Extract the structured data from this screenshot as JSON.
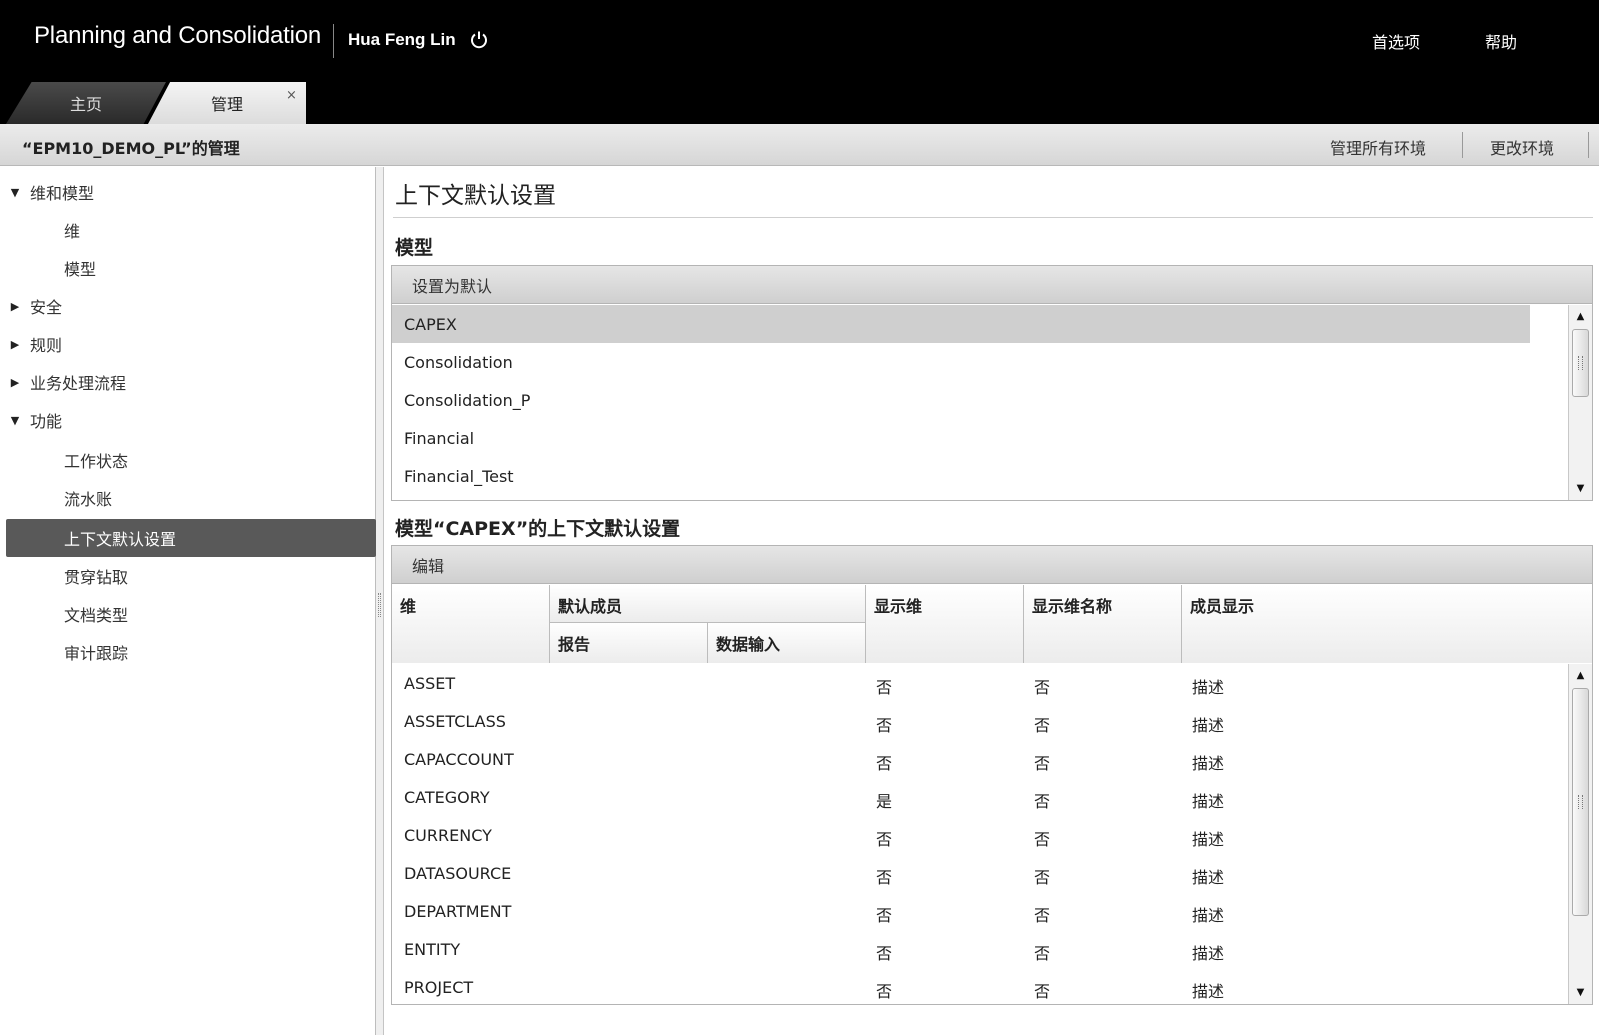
{
  "header": {
    "app_title": "Planning and Consolidation",
    "user_name": "Hua Feng Lin",
    "preferences": "首选项",
    "help": "帮助",
    "tabs": [
      "主页",
      "管理"
    ],
    "tab_close": "×"
  },
  "subheader": {
    "title": "“EPM10_DEMO_PL”的管理",
    "manage_all": "管理所有环境",
    "change_env": "更改环境"
  },
  "sidebar": {
    "items": [
      {
        "label": "维和模型",
        "type": "group",
        "expanded": true
      },
      {
        "label": "维",
        "type": "sub"
      },
      {
        "label": "模型",
        "type": "sub"
      },
      {
        "label": "安全",
        "type": "group",
        "expanded": false
      },
      {
        "label": "规则",
        "type": "group",
        "expanded": false
      },
      {
        "label": "业务处理流程",
        "type": "group",
        "expanded": false
      },
      {
        "label": "功能",
        "type": "group",
        "expanded": true
      },
      {
        "label": "工作状态",
        "type": "sub"
      },
      {
        "label": "流水账",
        "type": "sub"
      },
      {
        "label": "上下文默认设置",
        "type": "sub",
        "active": true
      },
      {
        "label": "贯穿钻取",
        "type": "sub"
      },
      {
        "label": "文档类型",
        "type": "sub"
      },
      {
        "label": "审计跟踪",
        "type": "sub"
      }
    ]
  },
  "main": {
    "title": "上下文默认设置",
    "models_heading": "模型",
    "set_default": "设置为默认",
    "models": [
      "CAPEX",
      "Consolidation",
      "Consolidation_P",
      "Financial",
      "Financial_Test"
    ],
    "selected_model": "CAPEX",
    "context_heading": "模型“CAPEX”的上下文默认设置",
    "edit": "编辑",
    "columns": {
      "dimension": "维",
      "default_member": "默认成员",
      "report": "报告",
      "data_input": "数据输入",
      "show_dim": "显示维",
      "show_dim_name": "显示维名称",
      "member_display": "成员显示"
    },
    "rows": [
      {
        "dim": "ASSET",
        "show": "否",
        "show_name": "否",
        "display": "描述"
      },
      {
        "dim": "ASSETCLASS",
        "show": "否",
        "show_name": "否",
        "display": "描述"
      },
      {
        "dim": "CAPACCOUNT",
        "show": "否",
        "show_name": "否",
        "display": "描述"
      },
      {
        "dim": "CATEGORY",
        "show": "是",
        "show_name": "否",
        "display": "描述"
      },
      {
        "dim": "CURRENCY",
        "show": "否",
        "show_name": "否",
        "display": "描述"
      },
      {
        "dim": "DATASOURCE",
        "show": "否",
        "show_name": "否",
        "display": "描述"
      },
      {
        "dim": "DEPARTMENT",
        "show": "否",
        "show_name": "否",
        "display": "描述"
      },
      {
        "dim": "ENTITY",
        "show": "否",
        "show_name": "否",
        "display": "描述"
      },
      {
        "dim": "PROJECT",
        "show": "否",
        "show_name": "否",
        "display": "描述"
      }
    ]
  }
}
